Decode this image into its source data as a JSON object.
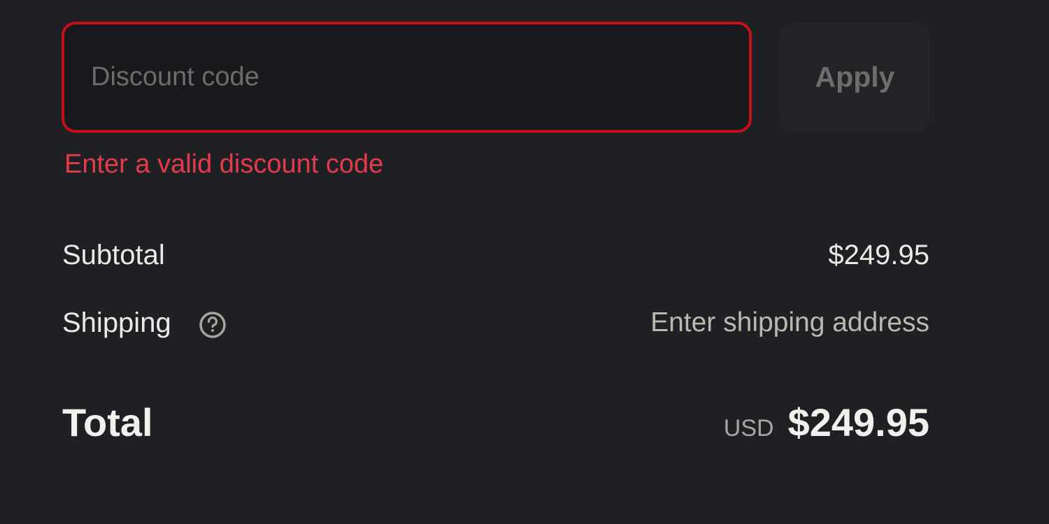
{
  "discount": {
    "placeholder": "Discount code",
    "value": "",
    "apply_label": "Apply",
    "error_message": "Enter a valid discount code"
  },
  "summary": {
    "subtotal_label": "Subtotal",
    "subtotal_value": "$249.95",
    "shipping_label": "Shipping",
    "shipping_info_icon": "info-icon",
    "shipping_value": "Enter shipping address",
    "total_label": "Total",
    "currency": "USD",
    "total_value": "$249.95"
  },
  "colors": {
    "background": "#1f2023",
    "error": "#e33a4c",
    "error_border": "#c4101d"
  }
}
